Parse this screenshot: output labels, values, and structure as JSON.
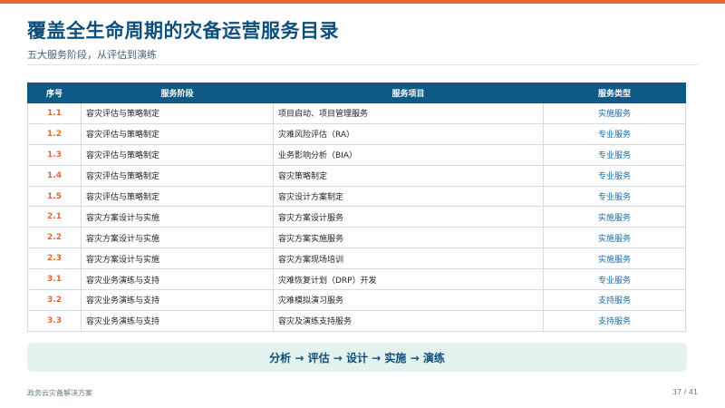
{
  "header": {
    "title": "覆盖全生命周期的灾备运营服务目录",
    "subtitle": "五大服务阶段，从评估到演练"
  },
  "table": {
    "columns": [
      "序号",
      "服务阶段",
      "服务项目",
      "服务类型"
    ],
    "rows": [
      {
        "no": "1.1",
        "stage": "容灾评估与策略制定",
        "item": "项目启动、项目管理服务",
        "type": "实施服务"
      },
      {
        "no": "1.2",
        "stage": "容灾评估与策略制定",
        "item": "灾难风险评估（RA）",
        "type": "专业服务"
      },
      {
        "no": "1.3",
        "stage": "容灾评估与策略制定",
        "item": "业务影响分析（BIA）",
        "type": "专业服务"
      },
      {
        "no": "1.4",
        "stage": "容灾评估与策略制定",
        "item": "容灾策略制定",
        "type": "专业服务"
      },
      {
        "no": "1.5",
        "stage": "容灾评估与策略制定",
        "item": "容灾设计方案制定",
        "type": "专业服务"
      },
      {
        "no": "2.1",
        "stage": "容灾方案设计与实施",
        "item": "容灾方案设计服务",
        "type": "实施服务"
      },
      {
        "no": "2.2",
        "stage": "容灾方案设计与实施",
        "item": "容灾方案实施服务",
        "type": "实施服务"
      },
      {
        "no": "2.3",
        "stage": "容灾方案设计与实施",
        "item": "容灾方案现场培训",
        "type": "实施服务"
      },
      {
        "no": "3.1",
        "stage": "容灾业务演练与支持",
        "item": "灾难恢复计划（DRP）开发",
        "type": "专业服务"
      },
      {
        "no": "3.2",
        "stage": "容灾业务演练与支持",
        "item": "灾难模拟演习服务",
        "type": "支持服务"
      },
      {
        "no": "3.3",
        "stage": "容灾业务演练与支持",
        "item": "容灾及演练支持服务",
        "type": "支持服务"
      }
    ]
  },
  "flow": {
    "text": "分析 → 评估 → 设计 → 实施 → 演练"
  },
  "footer": {
    "left": "政务云灾备解决方案",
    "page": "37 / 41"
  },
  "colors": {
    "accent_orange": "#e8662e",
    "header_blue": "#0d5a86",
    "title_blue": "#0d4f7a",
    "type_blue": "#1a6aa8",
    "flow_bg": "#e4f2ef"
  }
}
